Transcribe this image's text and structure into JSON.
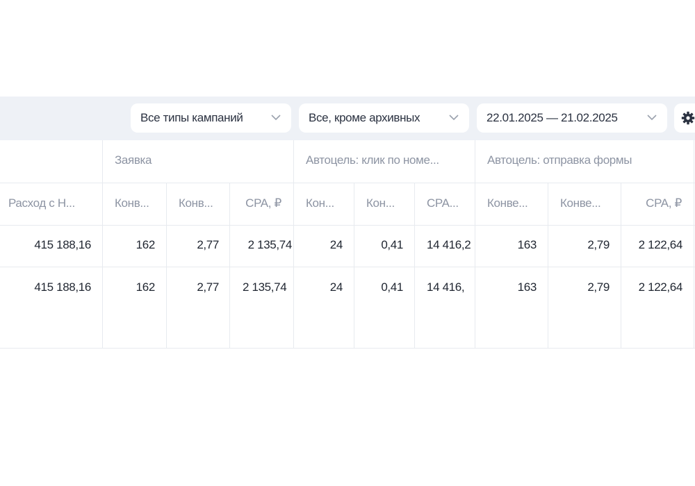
{
  "toolbar": {
    "campaign_types": "Все типы кампаний",
    "status_filter": "Все, кроме архивных",
    "date_range": "22.01.2025 — 21.02.2025"
  },
  "table": {
    "groups": [
      "Заявка",
      "Автоцель: клик по номе...",
      "Автоцель: отправка формы"
    ],
    "columns": [
      "Расход с Н...",
      "Конв...",
      "Конв...",
      "CPA, ₽",
      "Кон...",
      "Кон...",
      "CPA...",
      "Конве...",
      "Конве...",
      "CPA, ₽"
    ],
    "rows": [
      [
        "415 188,16",
        "162",
        "2,77",
        "2 135,74",
        "24",
        "0,41",
        "14 416,2",
        "163",
        "2,79",
        "2 122,64"
      ],
      [
        "415 188,16",
        "162",
        "2,77",
        "2 135,74",
        "24",
        "0,41",
        "14 416,",
        "163",
        "2,79",
        "2 122,64"
      ]
    ]
  }
}
